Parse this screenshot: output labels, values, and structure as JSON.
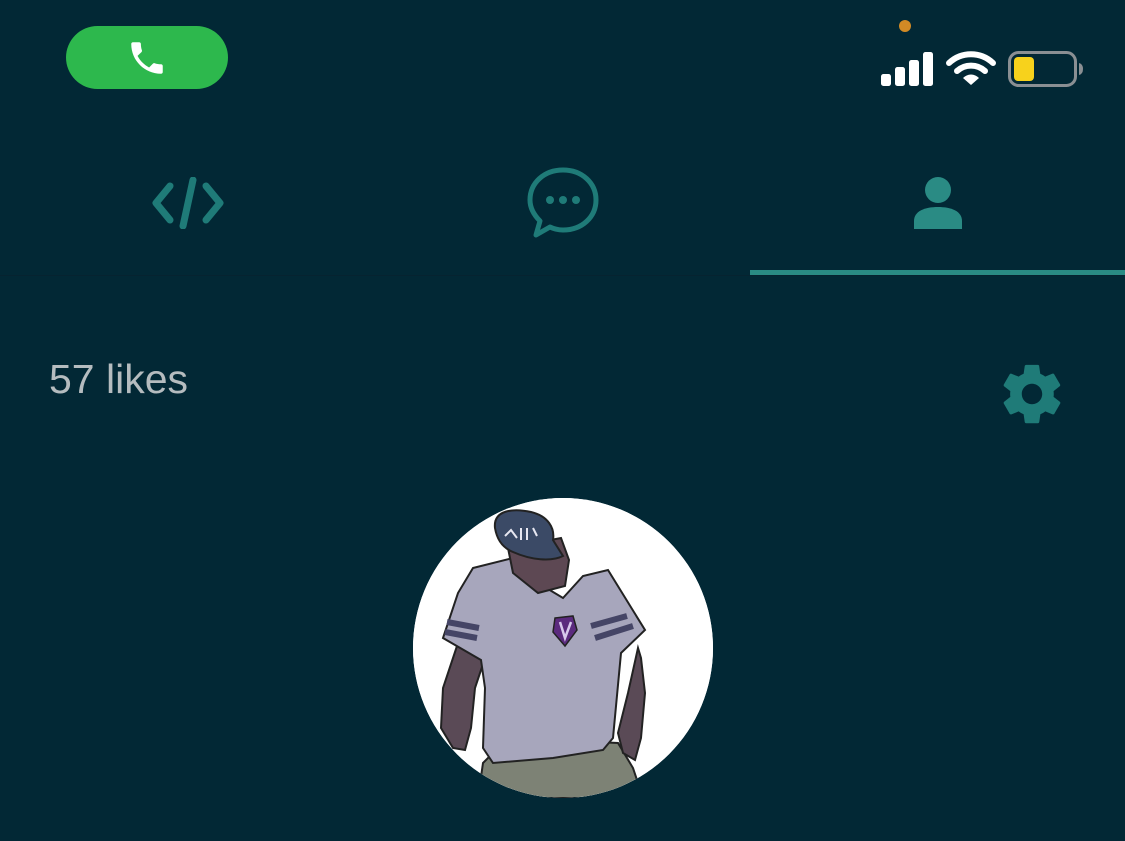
{
  "status_bar": {
    "call_icon": "phone-icon",
    "signal_icon": "cellular-signal-icon",
    "wifi_icon": "wifi-icon",
    "battery_icon": "battery-icon",
    "battery_level": 0.35,
    "colors": {
      "call_pill": "#2db84d",
      "privacy_dot": "#d18a25",
      "battery_fill": "#f7d21c"
    }
  },
  "tabs": [
    {
      "id": "code",
      "icon": "code-icon",
      "active": false
    },
    {
      "id": "chat",
      "icon": "chat-bubble-icon",
      "active": false
    },
    {
      "id": "profile",
      "icon": "person-icon",
      "active": true
    }
  ],
  "profile": {
    "likes_text": "57 likes",
    "settings_icon": "gear-icon",
    "avatar": "avatar-illustration"
  },
  "colors": {
    "background": "#022835",
    "accent": "#2a8b84",
    "text_muted": "#b5bcbf"
  }
}
